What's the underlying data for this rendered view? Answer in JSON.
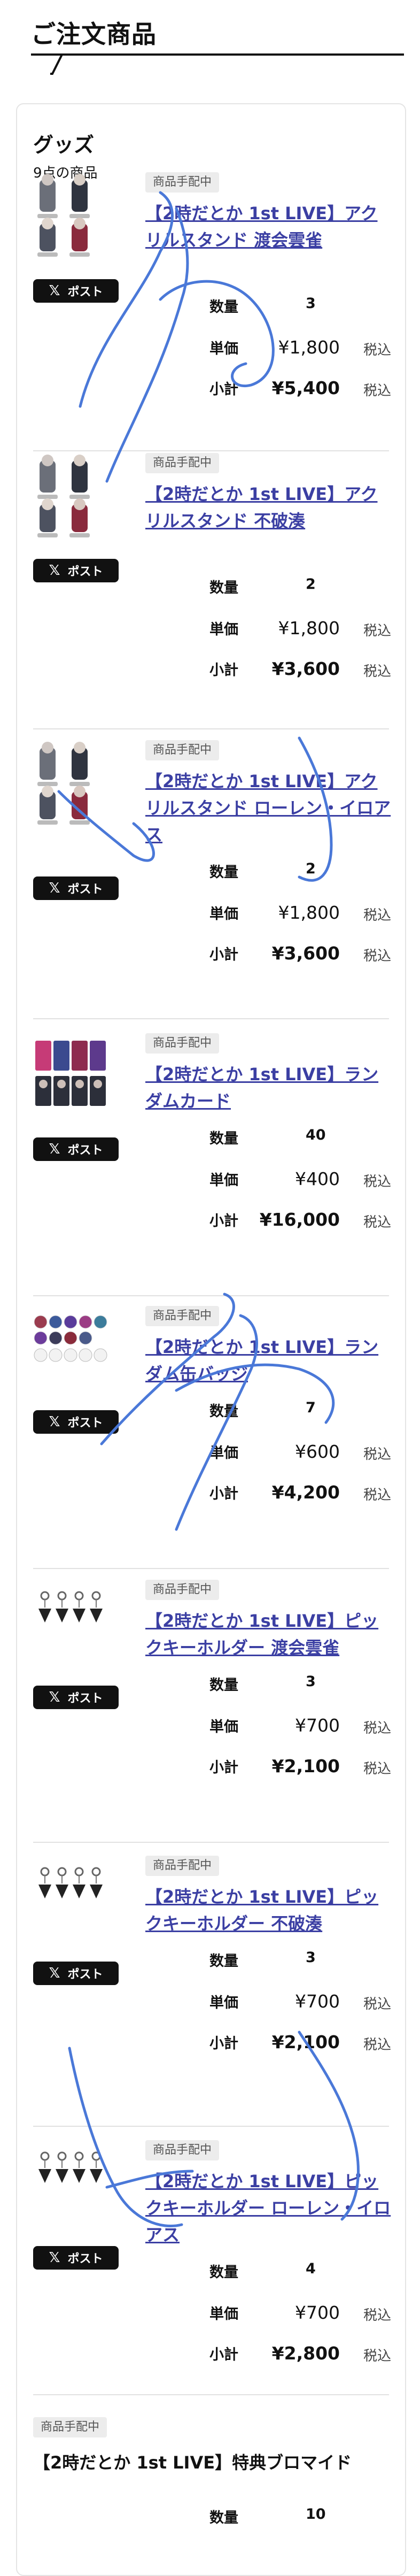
{
  "page": {
    "title": "ご注文商品"
  },
  "section": {
    "title": "グッズ",
    "count": "9点の商品"
  },
  "labels": {
    "quantity": "数量",
    "unit": "単価",
    "subtotal": "小計",
    "tax": "税込",
    "post": "ポスト",
    "status": "商品手配中"
  },
  "items": [
    {
      "name": "【2時だとか 1st LIVE】アクリルスタンド 渡会雲雀",
      "quantity": "3",
      "unit_price": "¥1,800",
      "subtotal": "¥5,400",
      "thumb": "acrylic-stand"
    },
    {
      "name": "【2時だとか 1st LIVE】アクリルスタンド 不破湊",
      "quantity": "2",
      "unit_price": "¥1,800",
      "subtotal": "¥3,600",
      "thumb": "acrylic-stand"
    },
    {
      "name": "【2時だとか 1st LIVE】アクリルスタンド ローレン・イロアス",
      "quantity": "2",
      "unit_price": "¥1,800",
      "subtotal": "¥3,600",
      "thumb": "acrylic-stand"
    },
    {
      "name": "【2時だとか 1st LIVE】ランダムカード",
      "quantity": "40",
      "unit_price": "¥400",
      "subtotal": "¥16,000",
      "thumb": "cards"
    },
    {
      "name": "【2時だとか 1st LIVE】ランダム缶バッジ",
      "quantity": "7",
      "unit_price": "¥600",
      "subtotal": "¥4,200",
      "thumb": "badges"
    },
    {
      "name": "【2時だとか 1st LIVE】ピックキーホルダー 渡会雲雀",
      "quantity": "3",
      "unit_price": "¥700",
      "subtotal": "¥2,100",
      "thumb": "keyholder"
    },
    {
      "name": "【2時だとか 1st LIVE】ピックキーホルダー 不破湊",
      "quantity": "3",
      "unit_price": "¥700",
      "subtotal": "¥2,100",
      "thumb": "keyholder"
    },
    {
      "name": "【2時だとか 1st LIVE】ピックキーホルダー ローレン・イロアス",
      "quantity": "4",
      "unit_price": "¥700",
      "subtotal": "¥2,800",
      "thumb": "keyholder"
    }
  ],
  "last_item": {
    "name": "【2時だとか 1st LIVE】特典ブロマイド",
    "quantity": "10"
  },
  "colors": {
    "link": "#3b3fa3",
    "badge_bg": "#ececec",
    "post_bg": "#111111",
    "scribble": "#4a78d8"
  }
}
